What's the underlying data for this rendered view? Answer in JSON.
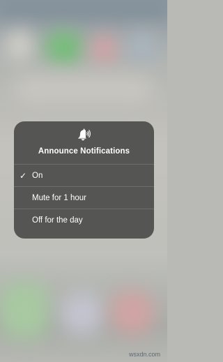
{
  "menu": {
    "icon": "announce-bell-icon",
    "title": "Announce Notifications",
    "options": [
      {
        "label": "On",
        "selected": true
      },
      {
        "label": "Mute for 1 hour",
        "selected": false
      },
      {
        "label": "Off for the day",
        "selected": false
      }
    ],
    "check_glyph": "✓"
  },
  "watermark": "wsxdn.com",
  "colors": {
    "menu_background": "#4c4d4c",
    "text": "#ffffff"
  }
}
